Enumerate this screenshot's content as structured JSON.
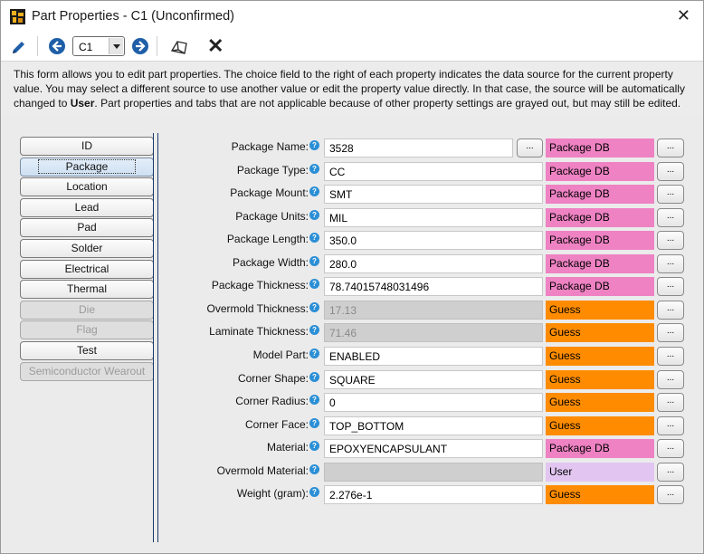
{
  "window": {
    "title": "Part Properties - C1 (Unconfirmed)",
    "close_glyph": "✕"
  },
  "toolbar": {
    "selected_part": "C1",
    "delete_glyph": "✕"
  },
  "description": {
    "text_before_bold": "This form allows you to edit part properties. The choice field to the right of each property indicates the data source for the current property value. You may select a different source to use another value or edit the property value directly. In that case, the source will be automatically changed to ",
    "bold": "User",
    "text_after_bold": ". Part properties and tabs that are not applicable because of other property settings are grayed out, but may still be edited."
  },
  "tabs": [
    {
      "label": "ID",
      "state": "normal"
    },
    {
      "label": "Package",
      "state": "active"
    },
    {
      "label": "Location",
      "state": "normal"
    },
    {
      "label": "Lead",
      "state": "normal"
    },
    {
      "label": "Pad",
      "state": "normal"
    },
    {
      "label": "Solder",
      "state": "normal"
    },
    {
      "label": "Electrical",
      "state": "normal"
    },
    {
      "label": "Thermal",
      "state": "normal"
    },
    {
      "label": "Die",
      "state": "disabled"
    },
    {
      "label": "Flag",
      "state": "disabled"
    },
    {
      "label": "Test",
      "state": "normal"
    },
    {
      "label": "Semiconductor Wearout",
      "state": "disabled"
    }
  ],
  "help_glyph": "?",
  "ellipsis": "...",
  "properties": [
    {
      "label": "Package Name:",
      "value": "3528",
      "source": "Package DB",
      "source_kind": "pkg",
      "disabled": false,
      "has_picker": true
    },
    {
      "label": "Package Type:",
      "value": "CC",
      "source": "Package DB",
      "source_kind": "pkg",
      "disabled": false,
      "has_picker": false
    },
    {
      "label": "Package Mount:",
      "value": "SMT",
      "source": "Package DB",
      "source_kind": "pkg",
      "disabled": false,
      "has_picker": false
    },
    {
      "label": "Package Units:",
      "value": "MIL",
      "source": "Package DB",
      "source_kind": "pkg",
      "disabled": false,
      "has_picker": false
    },
    {
      "label": "Package Length:",
      "value": "350.0",
      "source": "Package DB",
      "source_kind": "pkg",
      "disabled": false,
      "has_picker": false
    },
    {
      "label": "Package Width:",
      "value": "280.0",
      "source": "Package DB",
      "source_kind": "pkg",
      "disabled": false,
      "has_picker": false
    },
    {
      "label": "Package Thickness:",
      "value": "78.74015748031496",
      "source": "Package DB",
      "source_kind": "pkg",
      "disabled": false,
      "has_picker": false
    },
    {
      "label": "Overmold Thickness:",
      "value": "17.13",
      "source": "Guess",
      "source_kind": "guess",
      "disabled": true,
      "has_picker": false
    },
    {
      "label": "Laminate Thickness:",
      "value": "71.46",
      "source": "Guess",
      "source_kind": "guess",
      "disabled": true,
      "has_picker": false
    },
    {
      "label": "Model Part:",
      "value": "ENABLED",
      "source": "Guess",
      "source_kind": "guess",
      "disabled": false,
      "has_picker": false
    },
    {
      "label": "Corner Shape:",
      "value": "SQUARE",
      "source": "Guess",
      "source_kind": "guess",
      "disabled": false,
      "has_picker": false
    },
    {
      "label": "Corner Radius:",
      "value": "0",
      "source": "Guess",
      "source_kind": "guess",
      "disabled": false,
      "has_picker": false
    },
    {
      "label": "Corner Face:",
      "value": "TOP_BOTTOM",
      "source": "Guess",
      "source_kind": "guess",
      "disabled": false,
      "has_picker": false
    },
    {
      "label": "Material:",
      "value": "EPOXYENCAPSULANT",
      "source": "Package DB",
      "source_kind": "pkg",
      "disabled": false,
      "has_picker": false
    },
    {
      "label": "Overmold Material:",
      "value": "",
      "source": "User",
      "source_kind": "user",
      "disabled": true,
      "has_picker": false
    },
    {
      "label": "Weight (gram):",
      "value": "2.276e-1",
      "source": "Guess",
      "source_kind": "guess",
      "disabled": false,
      "has_picker": false
    }
  ]
}
